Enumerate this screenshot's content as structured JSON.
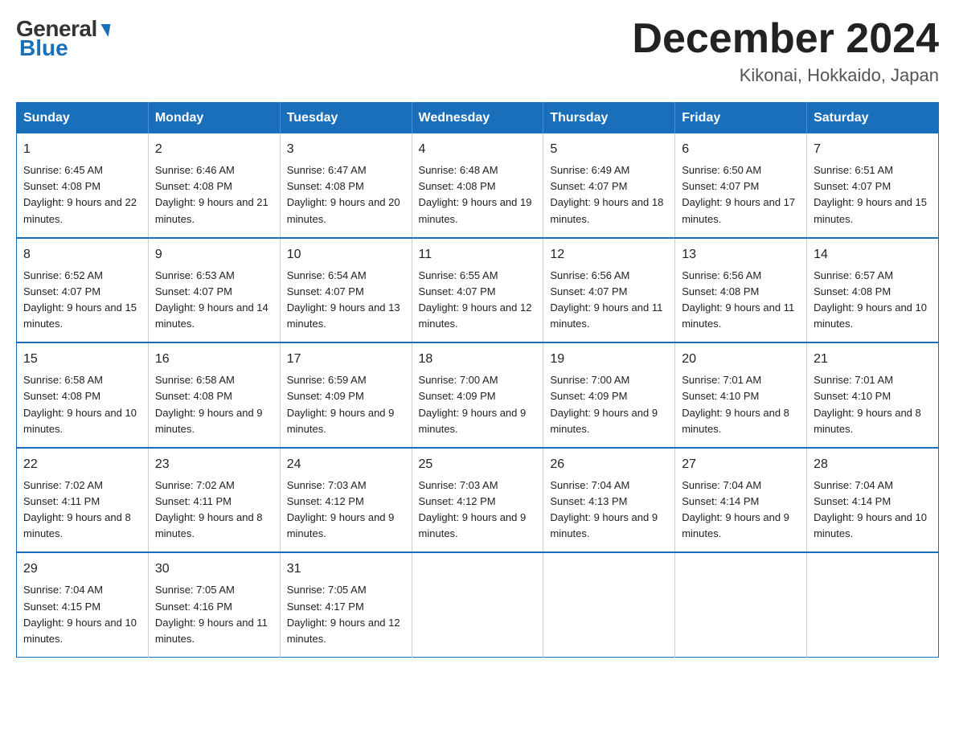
{
  "logo": {
    "general": "General",
    "blue": "Blue",
    "arrow": "▶"
  },
  "title": {
    "month_year": "December 2024",
    "location": "Kikonai, Hokkaido, Japan"
  },
  "header": {
    "days": [
      "Sunday",
      "Monday",
      "Tuesday",
      "Wednesday",
      "Thursday",
      "Friday",
      "Saturday"
    ]
  },
  "weeks": [
    [
      {
        "day": "1",
        "sunrise": "6:45 AM",
        "sunset": "4:08 PM",
        "daylight": "9 hours and 22 minutes."
      },
      {
        "day": "2",
        "sunrise": "6:46 AM",
        "sunset": "4:08 PM",
        "daylight": "9 hours and 21 minutes."
      },
      {
        "day": "3",
        "sunrise": "6:47 AM",
        "sunset": "4:08 PM",
        "daylight": "9 hours and 20 minutes."
      },
      {
        "day": "4",
        "sunrise": "6:48 AM",
        "sunset": "4:08 PM",
        "daylight": "9 hours and 19 minutes."
      },
      {
        "day": "5",
        "sunrise": "6:49 AM",
        "sunset": "4:07 PM",
        "daylight": "9 hours and 18 minutes."
      },
      {
        "day": "6",
        "sunrise": "6:50 AM",
        "sunset": "4:07 PM",
        "daylight": "9 hours and 17 minutes."
      },
      {
        "day": "7",
        "sunrise": "6:51 AM",
        "sunset": "4:07 PM",
        "daylight": "9 hours and 15 minutes."
      }
    ],
    [
      {
        "day": "8",
        "sunrise": "6:52 AM",
        "sunset": "4:07 PM",
        "daylight": "9 hours and 15 minutes."
      },
      {
        "day": "9",
        "sunrise": "6:53 AM",
        "sunset": "4:07 PM",
        "daylight": "9 hours and 14 minutes."
      },
      {
        "day": "10",
        "sunrise": "6:54 AM",
        "sunset": "4:07 PM",
        "daylight": "9 hours and 13 minutes."
      },
      {
        "day": "11",
        "sunrise": "6:55 AM",
        "sunset": "4:07 PM",
        "daylight": "9 hours and 12 minutes."
      },
      {
        "day": "12",
        "sunrise": "6:56 AM",
        "sunset": "4:07 PM",
        "daylight": "9 hours and 11 minutes."
      },
      {
        "day": "13",
        "sunrise": "6:56 AM",
        "sunset": "4:08 PM",
        "daylight": "9 hours and 11 minutes."
      },
      {
        "day": "14",
        "sunrise": "6:57 AM",
        "sunset": "4:08 PM",
        "daylight": "9 hours and 10 minutes."
      }
    ],
    [
      {
        "day": "15",
        "sunrise": "6:58 AM",
        "sunset": "4:08 PM",
        "daylight": "9 hours and 10 minutes."
      },
      {
        "day": "16",
        "sunrise": "6:58 AM",
        "sunset": "4:08 PM",
        "daylight": "9 hours and 9 minutes."
      },
      {
        "day": "17",
        "sunrise": "6:59 AM",
        "sunset": "4:09 PM",
        "daylight": "9 hours and 9 minutes."
      },
      {
        "day": "18",
        "sunrise": "7:00 AM",
        "sunset": "4:09 PM",
        "daylight": "9 hours and 9 minutes."
      },
      {
        "day": "19",
        "sunrise": "7:00 AM",
        "sunset": "4:09 PM",
        "daylight": "9 hours and 9 minutes."
      },
      {
        "day": "20",
        "sunrise": "7:01 AM",
        "sunset": "4:10 PM",
        "daylight": "9 hours and 8 minutes."
      },
      {
        "day": "21",
        "sunrise": "7:01 AM",
        "sunset": "4:10 PM",
        "daylight": "9 hours and 8 minutes."
      }
    ],
    [
      {
        "day": "22",
        "sunrise": "7:02 AM",
        "sunset": "4:11 PM",
        "daylight": "9 hours and 8 minutes."
      },
      {
        "day": "23",
        "sunrise": "7:02 AM",
        "sunset": "4:11 PM",
        "daylight": "9 hours and 8 minutes."
      },
      {
        "day": "24",
        "sunrise": "7:03 AM",
        "sunset": "4:12 PM",
        "daylight": "9 hours and 9 minutes."
      },
      {
        "day": "25",
        "sunrise": "7:03 AM",
        "sunset": "4:12 PM",
        "daylight": "9 hours and 9 minutes."
      },
      {
        "day": "26",
        "sunrise": "7:04 AM",
        "sunset": "4:13 PM",
        "daylight": "9 hours and 9 minutes."
      },
      {
        "day": "27",
        "sunrise": "7:04 AM",
        "sunset": "4:14 PM",
        "daylight": "9 hours and 9 minutes."
      },
      {
        "day": "28",
        "sunrise": "7:04 AM",
        "sunset": "4:14 PM",
        "daylight": "9 hours and 10 minutes."
      }
    ],
    [
      {
        "day": "29",
        "sunrise": "7:04 AM",
        "sunset": "4:15 PM",
        "daylight": "9 hours and 10 minutes."
      },
      {
        "day": "30",
        "sunrise": "7:05 AM",
        "sunset": "4:16 PM",
        "daylight": "9 hours and 11 minutes."
      },
      {
        "day": "31",
        "sunrise": "7:05 AM",
        "sunset": "4:17 PM",
        "daylight": "9 hours and 12 minutes."
      },
      null,
      null,
      null,
      null
    ]
  ]
}
